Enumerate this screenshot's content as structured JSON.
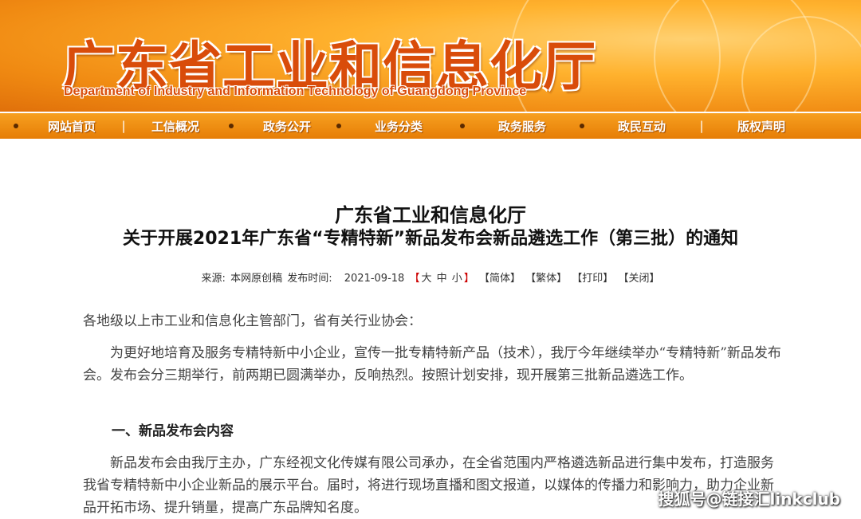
{
  "header": {
    "title": "广东省工业和信息化厅",
    "subtitle": "Department of Industry and Information Technology of Guangdong Province"
  },
  "nav": {
    "items": [
      "网站首页",
      "工信概况",
      "政务公开",
      "业务分类",
      "政务服务",
      "政民互动",
      "版权声明"
    ],
    "separator": "|"
  },
  "article": {
    "title_line1": "广东省工业和信息化厅",
    "title_line2": "关于开展2021年广东省“专精特新”新品发布会新品遴选工作（第三批）的通知",
    "meta": {
      "source_label": "来源:",
      "source_value": "本网原创稿",
      "publish_label": "发布时间:",
      "publish_date": "2021-09-18",
      "font_size_open": "【",
      "size_large": "大",
      "size_medium": "中",
      "size_small": "小",
      "font_size_close": "】",
      "simplified": "【简体】",
      "traditional": "【繁体】",
      "print": "【打印】",
      "close": "【关闭】"
    },
    "salutation": "各地级以上市工业和信息化主管部门，省有关行业协会：",
    "paragraph1": "为更好地培育及服务专精特新中小企业，宣传一批专精特新产品（技术），我厅今年继续举办“专精特新”新品发布会。发布会分三期举行，前两期已圆满举办，反响热烈。按照计划安排，现开展第三批新品遴选工作。",
    "section1_heading": "一、新品发布会内容",
    "paragraph2": "新品发布会由我厅主办，广东经视文化传媒有限公司承办，在全省范围内严格遴选新品进行集中发布，打造服务我省专精特新中小企业新品的展示平台。届时，将进行现场直播和图文报道，以媒体的传播力和影响力，助力企业新品开拓市场、提升销量，提高广东品牌知名度。"
  },
  "watermark": "搜狐号@链接汇linkclub",
  "colors": {
    "banner_orange": "#f08a12",
    "title_red": "#d94c0a",
    "nav_bar": "#e67d06"
  }
}
